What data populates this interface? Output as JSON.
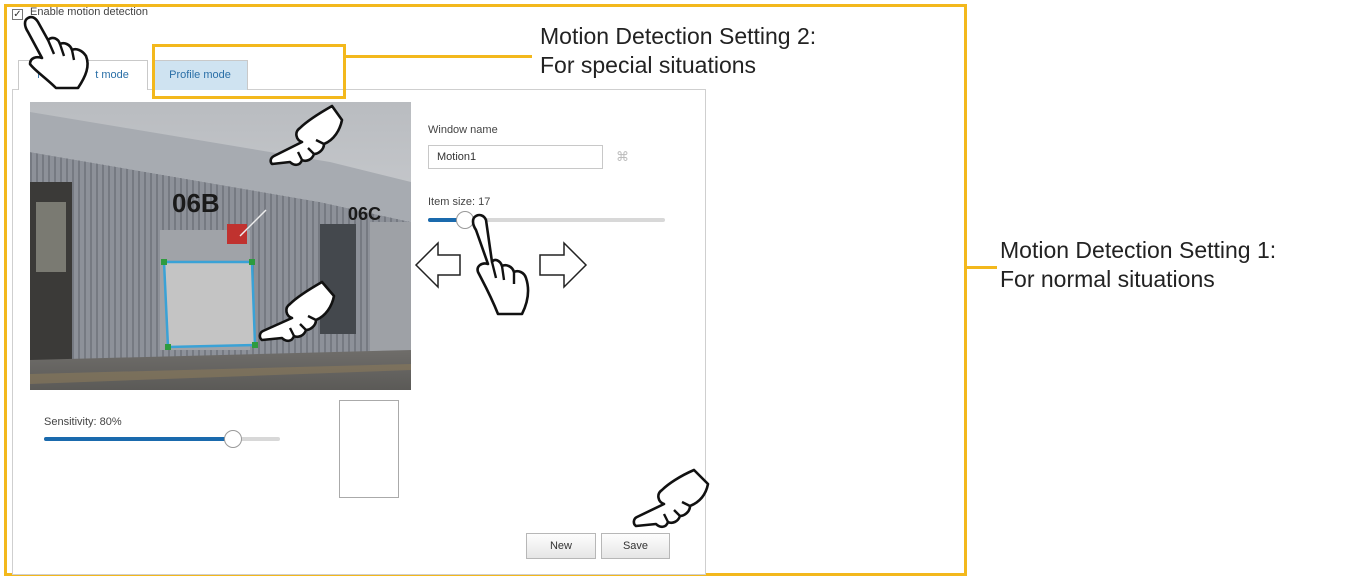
{
  "checkbox": {
    "checked": true,
    "label": "Enable motion detection"
  },
  "tabs": [
    {
      "label": "Normal mode",
      "visible_prefix": "No",
      "visible_suffix": "t mode",
      "active": false
    },
    {
      "label": "Profile mode",
      "active": true
    }
  ],
  "camera": {
    "building_labels": [
      "06B",
      "06C"
    ]
  },
  "window_name": {
    "label": "Window name",
    "value": "Motion1"
  },
  "item_size": {
    "label": "Item size: 17",
    "value": 17,
    "fraction": 0.15
  },
  "sensitivity": {
    "label": "Sensitivity: 80%",
    "value": 80
  },
  "buttons": {
    "new": "New",
    "save": "Save"
  },
  "callouts": {
    "setting2_line1": "Motion Detection Setting 2:",
    "setting2_line2": "For special situations",
    "setting1_line1": "Motion Detection Setting 1:",
    "setting1_line2": "For normal situations"
  },
  "colors": {
    "accent_frame": "#f3b81c",
    "slider_fill": "#1a6aad",
    "tab_active_bg": "#cfe3f1"
  }
}
